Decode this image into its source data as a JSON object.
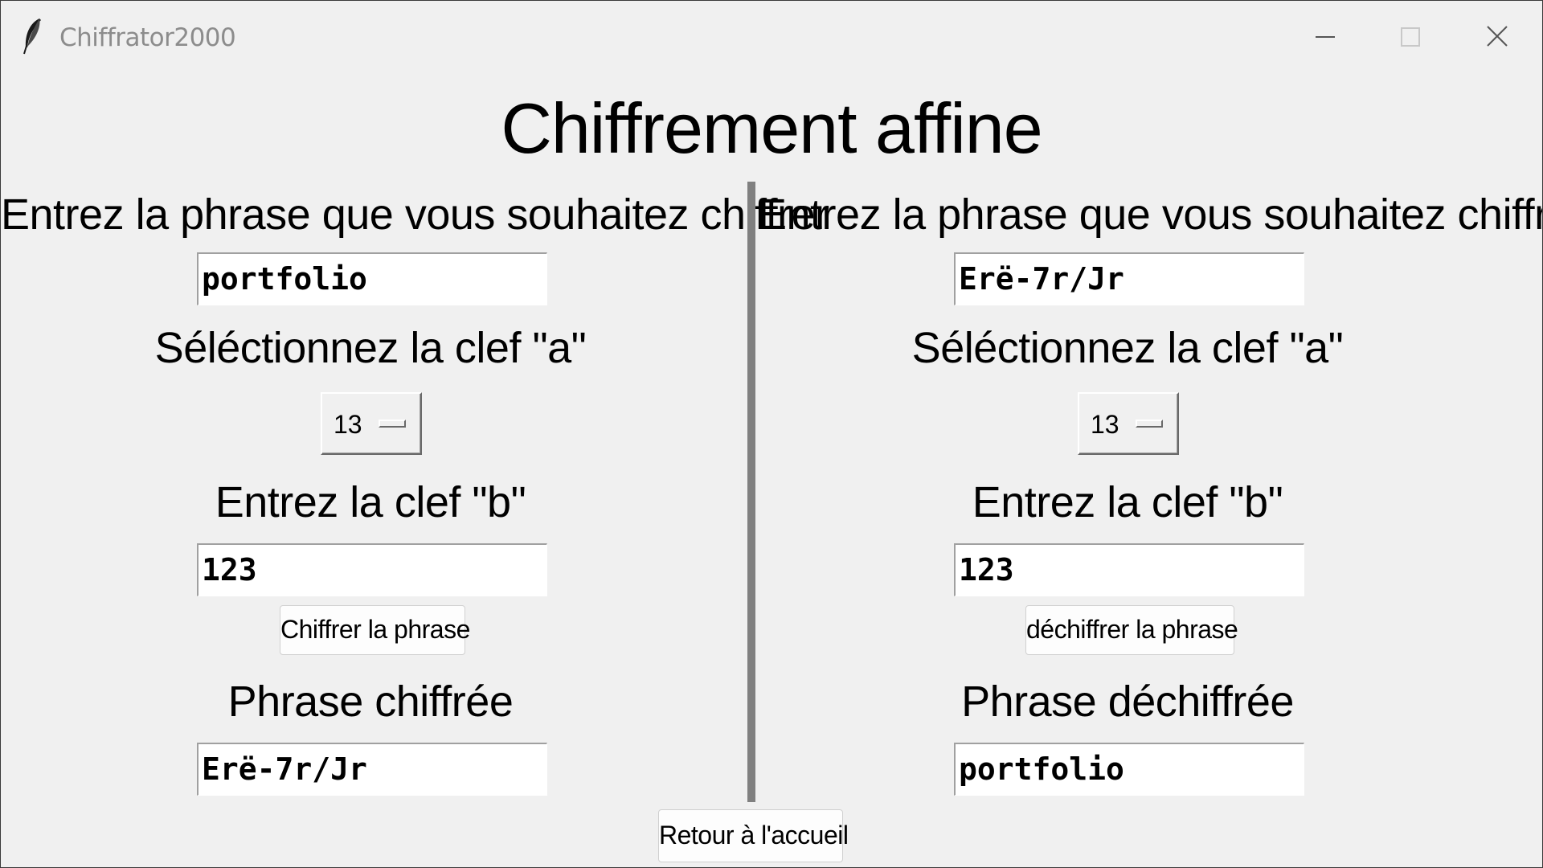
{
  "window": {
    "title": "Chiffrator2000"
  },
  "page": {
    "title": "Chiffrement affine"
  },
  "encrypt_panel": {
    "prompt_label": "Entrez la phrase que vous souhaitez chiffrer",
    "phrase_value": "portfolio",
    "key_a_label": "Séléctionnez la clef \"a\"",
    "key_a_value": "13",
    "key_b_label": "Entrez la clef \"b\"",
    "key_b_value": "123",
    "action_label": "Chiffrer la phrase",
    "result_label": "Phrase chiffrée",
    "result_value": "Erë-7r/Jr"
  },
  "decrypt_panel": {
    "prompt_label": "Entrez la phrase que vous souhaitez chiffrer",
    "phrase_value": "Erë-7r/Jr",
    "key_a_label": "Séléctionnez la clef \"a\"",
    "key_a_value": "13",
    "key_b_label": "Entrez la clef \"b\"",
    "key_b_value": "123",
    "action_label": "déchiffrer la phrase",
    "result_label": "Phrase déchiffrée",
    "result_value": "portfolio"
  },
  "footer": {
    "home_label": "Retour à l'accueil"
  },
  "icons": {
    "app": "feather-icon",
    "minimize": "minimize-icon",
    "maximize": "maximize-icon",
    "close": "close-icon"
  },
  "colors": {
    "background": "#f0f0f0",
    "divider": "#808080",
    "title_text": "#8c8c8c"
  }
}
